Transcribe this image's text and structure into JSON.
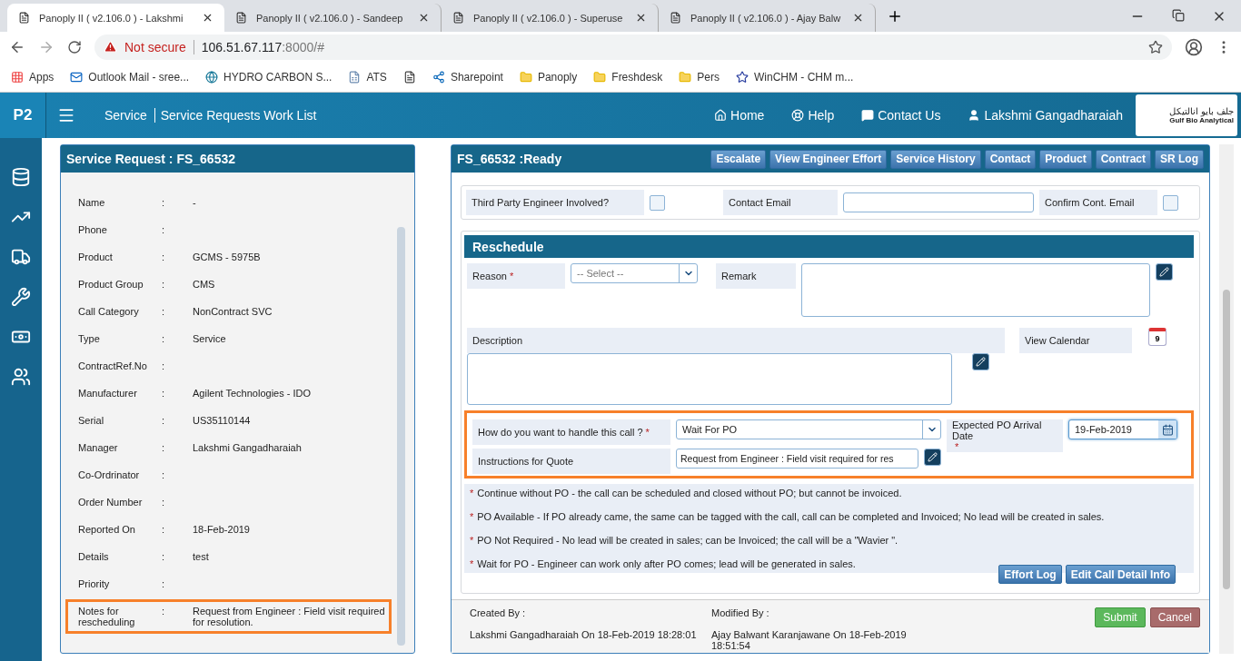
{
  "browser": {
    "tabs": [
      {
        "title": "Panoply II ( v2.106.0 ) - Lakshmi",
        "selected": true
      },
      {
        "title": "Panoply II ( v2.106.0 ) - Sandeep",
        "selected": false
      },
      {
        "title": "Panoply II ( v2.106.0 ) - Superuse",
        "selected": false
      },
      {
        "title": "Panoply II ( v2.106.0 ) - Ajay Balw",
        "selected": false
      }
    ],
    "address": {
      "security": "Not secure",
      "host": "106.51.67.117",
      "rest": ":8000/#"
    },
    "bookmarks": [
      {
        "kind": "apps",
        "label": "Apps"
      },
      {
        "kind": "outlook",
        "label": "Outlook Mail - sree..."
      },
      {
        "kind": "globe",
        "label": "HYDRO CARBON S..."
      },
      {
        "kind": "doc",
        "label": "ATS"
      },
      {
        "kind": "page"
      },
      {
        "kind": "sharepoint",
        "label": "Sharepoint"
      },
      {
        "kind": "folder",
        "label": "Panoply"
      },
      {
        "kind": "folder",
        "label": "Freshdesk"
      },
      {
        "kind": "folder",
        "label": "Pers"
      },
      {
        "kind": "star",
        "label": "WinCHM - CHM m..."
      }
    ]
  },
  "app": {
    "brand": "P2",
    "breadcrumb": [
      "Service",
      "Service Requests Work List"
    ],
    "nav": [
      {
        "kind": "home",
        "label": "Home"
      },
      {
        "kind": "help",
        "label": "Help"
      },
      {
        "kind": "chat",
        "label": "Contact Us"
      },
      {
        "kind": "user",
        "label": "Lakshmi Gangadharaiah"
      }
    ],
    "logo": {
      "arabic": "جلف بايو انالتيكل",
      "name": "Gulf Bio Analytical"
    },
    "sidebar": [
      {
        "kind": "database"
      },
      {
        "kind": "chart"
      },
      {
        "kind": "truck"
      },
      {
        "kind": "wrench"
      },
      {
        "kind": "money"
      },
      {
        "kind": "users"
      }
    ]
  },
  "service_request": {
    "title": "Service Request : FS_66532",
    "rows": [
      {
        "label": "Name",
        "value": "-",
        "highlighted": false
      },
      {
        "label": "Phone",
        "highlighted": false
      },
      {
        "label": "Product",
        "value": "GCMS - 5975B",
        "highlighted": false
      },
      {
        "label": "Product Group",
        "value": "CMS",
        "highlighted": false
      },
      {
        "label": "Call Category",
        "value": "NonContract SVC",
        "highlighted": false
      },
      {
        "label": "Type",
        "value": "Service",
        "highlighted": false
      },
      {
        "label": "ContractRef.No",
        "highlighted": false
      },
      {
        "label": "Manufacturer",
        "value": "Agilent Technologies - IDO",
        "highlighted": false
      },
      {
        "label": "Serial",
        "value": "US35110144",
        "highlighted": false
      },
      {
        "label": "Manager",
        "value": "Lakshmi Gangadharaiah",
        "highlighted": false
      },
      {
        "label": "Co-Ordrinator",
        "highlighted": false
      },
      {
        "label": "Order Number",
        "highlighted": false
      },
      {
        "label": "Reported On",
        "value": "18-Feb-2019",
        "highlighted": false
      },
      {
        "label": "Details",
        "value": "test",
        "highlighted": false
      },
      {
        "label": "Priority",
        "highlighted": false
      },
      {
        "label": "Notes for rescheduling",
        "value": "Request from Engineer : Field visit required for resolution.",
        "highlighted": true
      }
    ],
    "separator": ":"
  },
  "detail": {
    "title": "FS_66532 :Ready",
    "actions": [
      "Escalate",
      "View Engineer Effort",
      "Service History",
      "Contact",
      "Product",
      "Contract",
      "SR Log"
    ],
    "third_party": {
      "label": "Third Party Engineer Involved?",
      "checked": false
    },
    "contact_email": {
      "label": "Contact Email"
    },
    "confirm_email": {
      "label": "Confirm Cont. Email",
      "checked": false
    },
    "reschedule": {
      "title": "Reschedule",
      "reason": {
        "label": "Reason",
        "mark": "*",
        "placeholder": "-- Select --"
      },
      "remark": {
        "label": "Remark"
      },
      "description": {
        "label": "Description"
      },
      "view_calendar": {
        "label": "View Calendar",
        "day": "9"
      },
      "handle": {
        "label": "How do you want to handle this call ?",
        "mark": "*",
        "value": "Wait For PO"
      },
      "expected": {
        "label": "Expected PO Arrival Date",
        "mark": "*",
        "value": "19-Feb-2019"
      },
      "instructions": {
        "label": "Instructions for Quote",
        "value": "Request from Engineer : Field visit required for res"
      },
      "highlighted": true,
      "notes": [
        {
          "mark": "*",
          "text": "Continue without PO - the call can be scheduled and closed without PO; but cannot be invoiced."
        },
        {
          "mark": "*",
          "text": "PO Available - If PO already came, the same can be tagged with the call, call can be completed and Invoiced; No lead will be created in sales."
        },
        {
          "mark": "*",
          "text": "PO Not Required - No lead will be created in sales; can be Invoiced; the call will be a \"Wavier \"."
        },
        {
          "mark": "*",
          "text": "Wait for PO - Engineer can work only after PO comes; lead will be generated in sales."
        }
      ],
      "buttons": [
        "Effort Log",
        "Edit Call Detail Info"
      ]
    },
    "created": {
      "label": "Created By :",
      "value": "Lakshmi Gangadharaiah On 18-Feb-2019 18:28:01"
    },
    "modified": {
      "label": "Modified By :",
      "value": "Ajay Balwant Karanjawane On 18-Feb-2019 18:51:54"
    },
    "submit": "Submit",
    "cancel": "Cancel"
  }
}
